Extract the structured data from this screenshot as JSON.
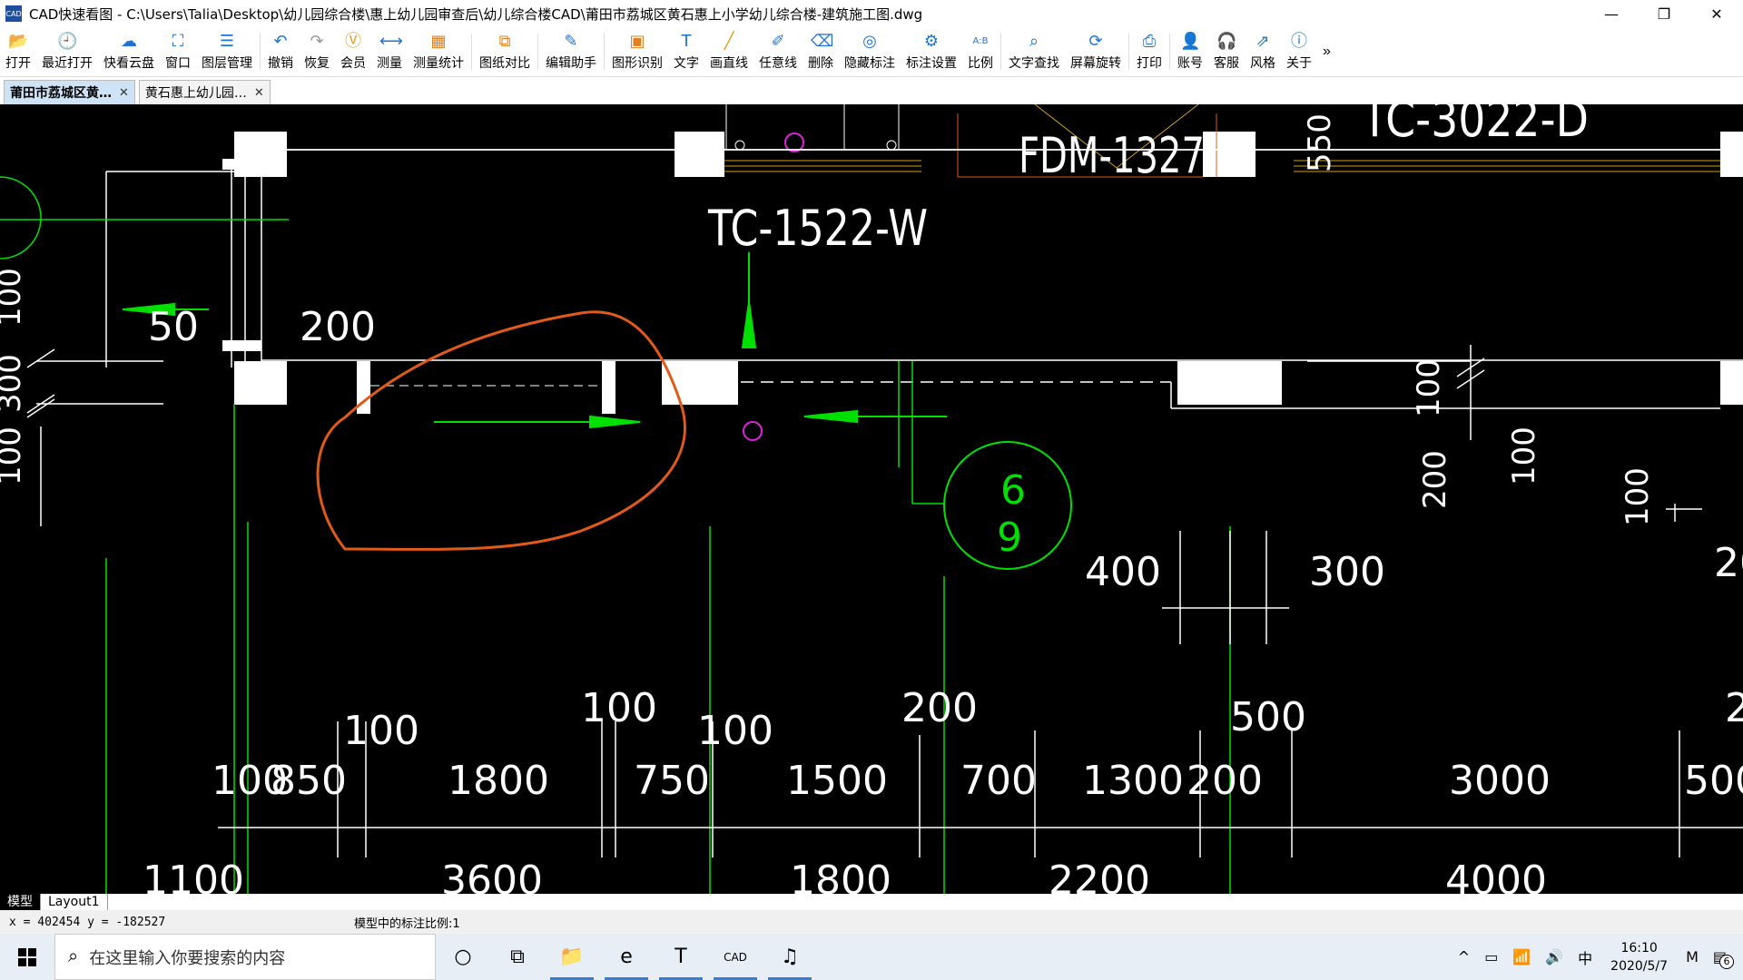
{
  "window": {
    "app_icon": "CAD",
    "title": "CAD快速看图 - C:\\Users\\Talia\\Desktop\\幼儿园综合楼\\惠上幼儿园审查后\\幼儿综合楼CAD\\莆田市荔城区黄石惠上小学幼儿综合楼-建筑施工图.dwg",
    "controls": {
      "minimize": "—",
      "restore": "❐",
      "close": "✕"
    }
  },
  "toolbar": {
    "items": [
      {
        "label": "打开",
        "icon": "folder-icon",
        "glyph": "📂",
        "color": "#1e73d8"
      },
      {
        "label": "最近打开",
        "icon": "recent-icon",
        "glyph": "🕘",
        "color": "#1e73d8"
      },
      {
        "label": "快看云盘",
        "icon": "cloud-icon",
        "glyph": "☁",
        "color": "#1e73d8"
      },
      {
        "label": "窗口",
        "icon": "window-icon",
        "glyph": "⛶",
        "color": "#1e73d8"
      },
      {
        "label": "图层管理",
        "icon": "layers-icon",
        "glyph": "☰",
        "color": "#1e73d8"
      },
      {
        "label": "撤销",
        "icon": "undo-icon",
        "glyph": "↶",
        "color": "#1e73d8"
      },
      {
        "label": "恢复",
        "icon": "redo-icon",
        "glyph": "↷",
        "color": "#999999"
      },
      {
        "label": "会员",
        "icon": "vip-icon",
        "glyph": "Ⓥ",
        "color": "#e0a020"
      },
      {
        "label": "测量",
        "icon": "measure-icon",
        "glyph": "⟷",
        "color": "#1e73d8"
      },
      {
        "label": "测量统计",
        "icon": "measure-stats-icon",
        "glyph": "▦",
        "color": "#e08020"
      },
      {
        "label": "图纸对比",
        "icon": "compare-icon",
        "glyph": "⧉",
        "color": "#e08020"
      },
      {
        "label": "编辑助手",
        "icon": "edit-assistant-icon",
        "glyph": "✎",
        "color": "#1e73d8"
      },
      {
        "label": "图形识别",
        "icon": "shape-recognize-icon",
        "glyph": "▣",
        "color": "#e08020"
      },
      {
        "label": "文字",
        "icon": "text-icon",
        "glyph": "T",
        "color": "#1e73d8"
      },
      {
        "label": "画直线",
        "icon": "line-icon",
        "glyph": "╱",
        "color": "#e0a020"
      },
      {
        "label": "任意线",
        "icon": "freehand-icon",
        "glyph": "✐",
        "color": "#1e73d8"
      },
      {
        "label": "删除",
        "icon": "eraser-icon",
        "glyph": "⌫",
        "color": "#1e73d8"
      },
      {
        "label": "隐藏标注",
        "icon": "hide-annotation-icon",
        "glyph": "◎",
        "color": "#1e73d8"
      },
      {
        "label": "标注设置",
        "icon": "annotation-settings-icon",
        "glyph": "⚙",
        "color": "#1e73d8"
      },
      {
        "label": "比例",
        "icon": "scale-icon",
        "glyph": "A:B",
        "color": "#1e73d8"
      },
      {
        "label": "文字查找",
        "icon": "text-search-icon",
        "glyph": "⌕",
        "color": "#1e73d8"
      },
      {
        "label": "屏幕旋转",
        "icon": "rotate-screen-icon",
        "glyph": "⟳",
        "color": "#1e73d8"
      },
      {
        "label": "打印",
        "icon": "print-icon",
        "glyph": "⎙",
        "color": "#1e73d8"
      },
      {
        "label": "账号",
        "icon": "account-icon",
        "glyph": "👤",
        "color": "#1e73d8"
      },
      {
        "label": "客服",
        "icon": "support-icon",
        "glyph": "🎧",
        "color": "#1e73d8"
      },
      {
        "label": "风格",
        "icon": "style-icon",
        "glyph": "⇗",
        "color": "#1e73d8"
      },
      {
        "label": "关于",
        "icon": "about-icon",
        "glyph": "ⓘ",
        "color": "#1e73d8"
      }
    ],
    "more": "»"
  },
  "tabs": [
    {
      "label": "莆田市荔城区黄…",
      "close": "✕",
      "active": true
    },
    {
      "label": "黄石惠上幼儿园…",
      "close": "✕",
      "active": false
    }
  ],
  "drawing": {
    "labels": {
      "tc1522": "TC-1522-W",
      "fdm": "FDM-1327",
      "tc3022": "TC-3022-D",
      "n550": "550",
      "n50": "50",
      "n200a": "200",
      "n100left": "100",
      "n300left": "300",
      "n100left2": "100",
      "n100r1": "100",
      "n100r2": "100",
      "n200r": "200",
      "n100r3": "100",
      "n400": "400",
      "n300": "300",
      "n20edge": "20",
      "axis_top": "6",
      "axis_bottom": "9",
      "d100a": "100",
      "d100b": "100",
      "d100c": "100",
      "d200": "200",
      "d500": "500",
      "d2edge": "2",
      "d100": "100",
      "d850": "850",
      "d1800": "1800",
      "d750": "750",
      "d1500": "1500",
      "d700": "700",
      "d1300": "1300",
      "d200b": "200",
      "d3000": "3000",
      "d500b": "500",
      "b1100": "1100",
      "b3600": "3600",
      "b1800": "1800",
      "b2200": "2200",
      "b4000": "4000"
    },
    "colors": {
      "wall": "#ffffff",
      "dim": "#ffffff",
      "green": "#00e000",
      "orange": "#e05a1a",
      "yellow": "#d4a017",
      "magenta": "#e020e0"
    }
  },
  "layout_tabs": [
    {
      "label": "模型",
      "active": true
    },
    {
      "label": "Layout1",
      "active": false
    }
  ],
  "status": {
    "coords": "x = 402454 y = -182527",
    "scale_text": "模型中的标注比例:1"
  },
  "taskbar": {
    "search_placeholder": "在这里输入你要搜索的内容",
    "apps": [
      {
        "name": "cortana-icon",
        "glyph": "○"
      },
      {
        "name": "task-view-icon",
        "glyph": "⧉"
      },
      {
        "name": "file-explorer-icon",
        "glyph": "📁"
      },
      {
        "name": "edge-icon",
        "glyph": "e"
      },
      {
        "name": "t-app-icon",
        "glyph": "T"
      },
      {
        "name": "cad-app-icon",
        "glyph": "CAD"
      },
      {
        "name": "netease-music-icon",
        "glyph": "♫"
      }
    ],
    "tray": {
      "chevron": "^",
      "battery": "▭",
      "wifi": "📶",
      "volume": "🔊",
      "ime": "中",
      "time": "16:10",
      "date": "2020/5/7",
      "ime2": "M",
      "notifications": "6"
    }
  }
}
